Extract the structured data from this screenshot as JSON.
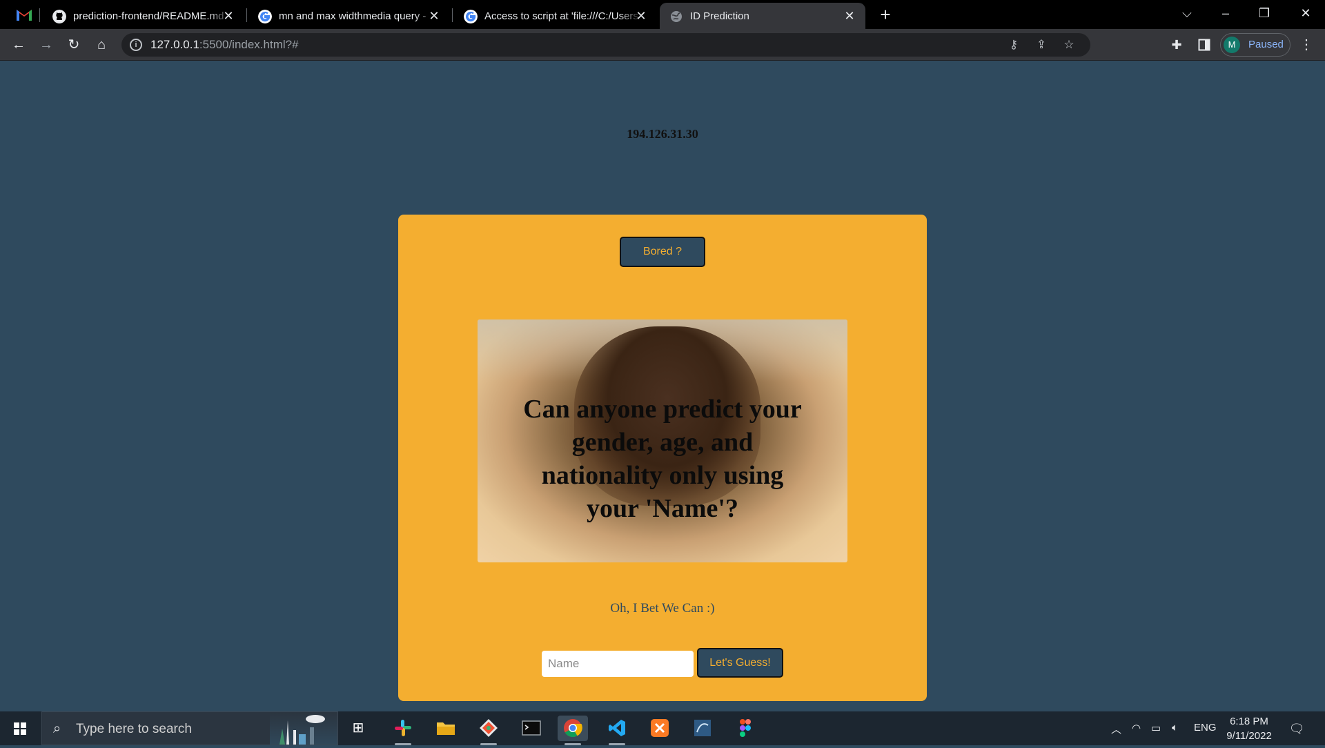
{
  "browser": {
    "tabs": [
      {
        "title": "prediction-frontend/README.md",
        "favicon": "github-icon",
        "active": false
      },
      {
        "title": "mn and max widthmedia query -",
        "favicon": "google-icon",
        "active": false
      },
      {
        "title": "Access to script at 'file:///C:/Users",
        "favicon": "google-icon",
        "active": false
      },
      {
        "title": "ID Prediction",
        "favicon": "globe-icon",
        "active": true
      }
    ],
    "address": {
      "host": "127.0.0.1",
      "rest": ":5500/index.html?#"
    },
    "profile": {
      "initial": "M",
      "status": "Paused"
    }
  },
  "page": {
    "ip": "194.126.31.30",
    "bored_label": "Bored ?",
    "headline": "Can anyone predict your gender, age, and nationality only using your 'Name'?",
    "tagline": "Oh, I Bet We Can :)",
    "name_placeholder": "Name",
    "guess_label": "Let's Guess!"
  },
  "taskbar": {
    "search_placeholder": "Type here to search",
    "language": "ENG",
    "time": "6:18 PM",
    "date": "9/11/2022"
  },
  "colors": {
    "page_bg": "#2f4a5e",
    "card_bg": "#f4ae30",
    "button_bg": "#2f4a5e",
    "button_text": "#f4ae30"
  }
}
